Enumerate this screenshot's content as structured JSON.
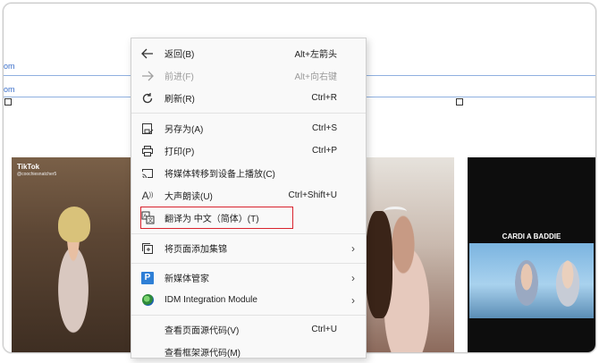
{
  "background": {
    "links": [
      "om",
      "om"
    ],
    "tiles": {
      "tiktok_logo": "TikTok",
      "tiktok_user": "@coochiesnatcher5",
      "caption": "CARDI A BADDIE"
    }
  },
  "menu": {
    "items": [
      {
        "key": "back",
        "icon": "back-arrow-icon",
        "label": "返回(B)",
        "shortcut": "Alt+左箭头",
        "enabled": true
      },
      {
        "key": "forward",
        "icon": "forward-arrow-icon",
        "label": "前进(F)",
        "shortcut": "Alt+向右键",
        "enabled": false
      },
      {
        "key": "refresh",
        "icon": "refresh-icon",
        "label": "刷新(R)",
        "shortcut": "Ctrl+R",
        "enabled": true
      },
      {
        "key": "save_as",
        "icon": "save-as-icon",
        "label": "另存为(A)",
        "shortcut": "Ctrl+S",
        "enabled": true
      },
      {
        "key": "print",
        "icon": "printer-icon",
        "label": "打印(P)",
        "shortcut": "Ctrl+P",
        "enabled": true
      },
      {
        "key": "cast",
        "icon": "cast-icon",
        "label": "将媒体转移到设备上播放(C)",
        "shortcut": "",
        "enabled": true
      },
      {
        "key": "read_aloud",
        "icon": "read-aloud-icon",
        "label": "大声朗读(U)",
        "shortcut": "Ctrl+Shift+U",
        "enabled": true
      },
      {
        "key": "translate",
        "icon": "translate-icon",
        "label": "翻译为 中文（简体）(T)",
        "shortcut": "",
        "enabled": true
      },
      {
        "key": "collections",
        "icon": "collections-icon",
        "label": "将页面添加集锦",
        "shortcut": "",
        "enabled": true,
        "submenu": true
      },
      {
        "key": "media_manager",
        "icon": "p-icon",
        "label": "新媒体管家",
        "shortcut": "",
        "enabled": true,
        "submenu": true
      },
      {
        "key": "idm",
        "icon": "idm-icon",
        "label": "IDM Integration Module",
        "shortcut": "",
        "enabled": true,
        "submenu": true
      },
      {
        "key": "view_source",
        "icon": "",
        "label": "查看页面源代码(V)",
        "shortcut": "Ctrl+U",
        "enabled": true
      },
      {
        "key": "view_frame_source",
        "icon": "",
        "label": "查看框架源代码(M)",
        "shortcut": "",
        "enabled": true
      }
    ]
  },
  "colors": {
    "highlight_border": "#d9232d",
    "menu_bg": "#f9f9f9"
  }
}
